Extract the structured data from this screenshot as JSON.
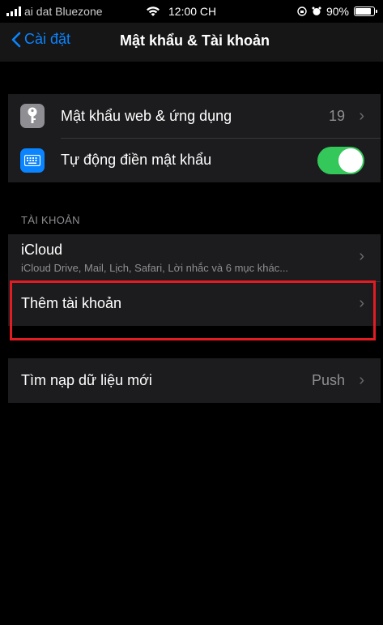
{
  "status_bar": {
    "carrier": "ai dat Bluezone",
    "time": "12:00 CH",
    "battery_percent": "90%",
    "battery_level": 0.9
  },
  "nav": {
    "back_label": "Cài đặt",
    "title": "Mật khẩu & Tài khoản"
  },
  "passwords_group": {
    "web_passwords": {
      "label": "Mật khẩu web & ứng dụng",
      "count": "19",
      "icon": "key-icon"
    },
    "autofill": {
      "label": "Tự động điền mật khẩu",
      "icon": "keyboard-icon",
      "enabled": true
    }
  },
  "accounts": {
    "header": "TÀI KHOẢN",
    "icloud": {
      "label": "iCloud",
      "subtitle": "iCloud Drive, Mail, Lịch, Safari, Lời nhắc và 6 mục khác..."
    },
    "add_account": {
      "label": "Thêm tài khoản"
    }
  },
  "fetch": {
    "label": "Tìm nạp dữ liệu mới",
    "value": "Push"
  },
  "colors": {
    "accent": "#0a84ff",
    "toggle_on": "#34c759",
    "highlight": "#e31b23"
  }
}
